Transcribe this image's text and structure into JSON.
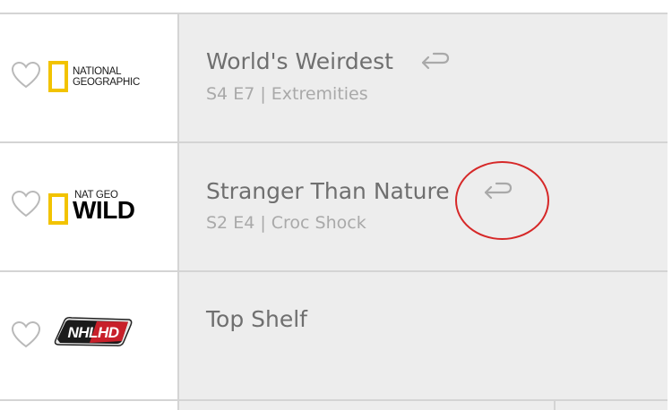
{
  "guide": {
    "rows": [
      {
        "channel": {
          "logo_name": "national-geographic-logo",
          "logo_line1": "National",
          "logo_line2": "Geographic"
        },
        "program": {
          "title": "World's Weirdest",
          "episode": "S4 E7 | Extremities",
          "has_replay": true
        }
      },
      {
        "channel": {
          "logo_name": "nat-geo-wild-logo",
          "logo_line1": "NAT GEO",
          "logo_line2": "WILD"
        },
        "program": {
          "title": "Stranger Than Nature",
          "episode": "S2 E4 | Croc Shock",
          "has_replay": true
        }
      },
      {
        "channel": {
          "logo_name": "nhl-hd-logo",
          "logo_text": "NHLHD"
        },
        "program": {
          "title": "Top Shelf",
          "has_replay": false
        }
      }
    ]
  },
  "colors": {
    "cell_bg": "#ededed",
    "divider": "#d4d4d4",
    "title": "#6f6f6f",
    "subtitle": "#a9a9a9",
    "annotation": "#d62828",
    "natgeo_yellow": "#f2c300"
  },
  "icons": {
    "favorite": "heart-outline-icon",
    "replay": "replay-arrow-icon"
  }
}
